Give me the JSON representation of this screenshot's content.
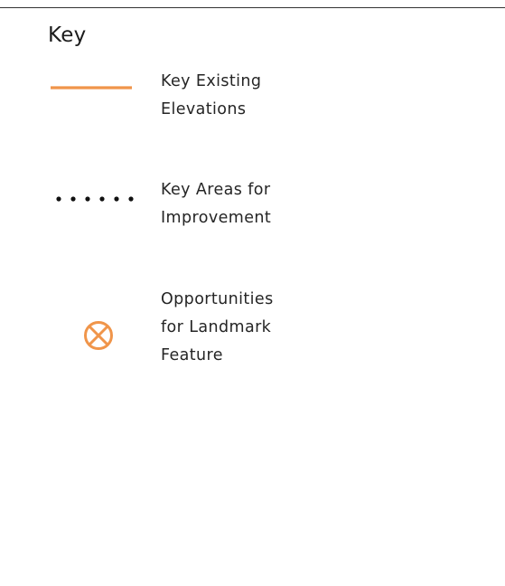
{
  "key": {
    "title": "Key",
    "items": [
      {
        "symbol": "orange-solid-line",
        "color": "#f0954a",
        "label_lines": [
          "Key Existing",
          "Elevations"
        ]
      },
      {
        "symbol": "black-dotted-line",
        "color": "#111111",
        "label_lines": [
          "Key Areas for",
          "Improvement"
        ]
      },
      {
        "symbol": "orange-circled-cross-icon",
        "color": "#f0954a",
        "label_lines": [
          "Opportunities",
          "for Landmark",
          "Feature"
        ]
      }
    ]
  }
}
